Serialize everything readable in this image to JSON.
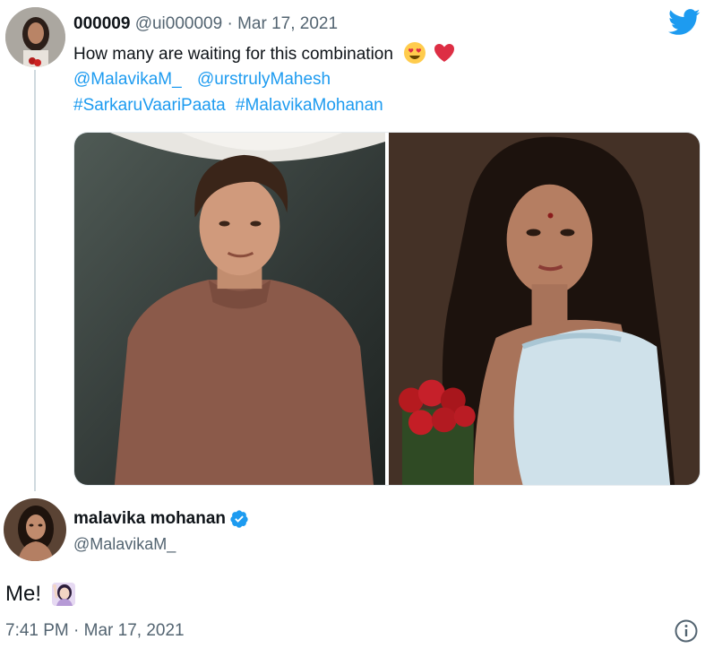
{
  "tweet1": {
    "display_name": "000009",
    "handle": "@ui000009",
    "separator": "·",
    "date": "Mar 17, 2021",
    "text": "How many are waiting for this combination",
    "emojis": [
      "heart-eyes-emoji",
      "red-heart-emoji"
    ],
    "mentions": [
      "@MalavikaM_",
      "@urstrulyMahesh"
    ],
    "hashtags": [
      "#SarkaruVaariPaata",
      "#MalavikaMohanan"
    ],
    "media": [
      "photo-man-brown-tshirt",
      "photo-woman-saree-roses"
    ]
  },
  "tweet2": {
    "display_name": "malavika mohanan",
    "verified": true,
    "handle": "@MalavikaM_",
    "text": "Me!",
    "emoji": "woman-raising-hand-emoji",
    "timestamp": "7:41 PM · Mar 17, 2021"
  },
  "icons": {
    "brand": "twitter-bird-icon",
    "info": "info-icon",
    "verified": "verified-badge-icon"
  },
  "colors": {
    "link": "#1d9bf0",
    "secondary_text": "#536471",
    "primary_text": "#0f1419",
    "thread_line": "#cfd9de"
  }
}
